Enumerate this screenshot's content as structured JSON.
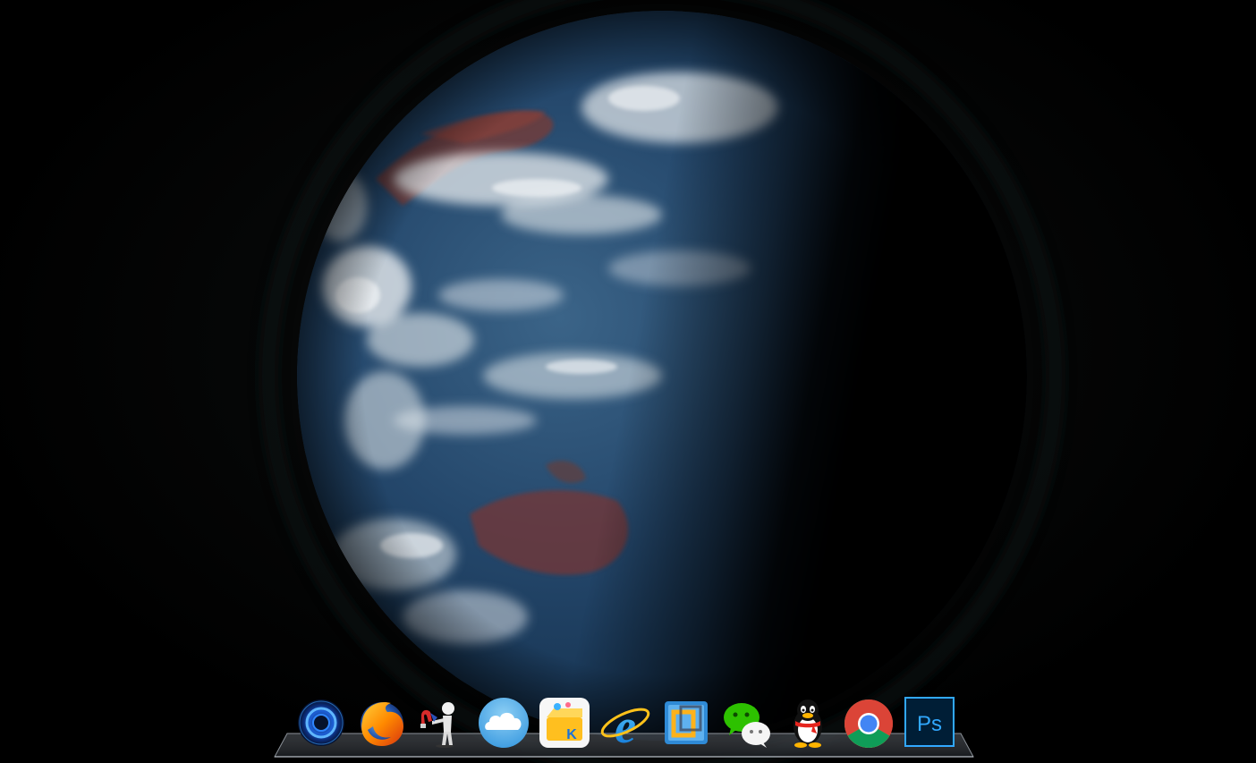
{
  "desktop": {
    "wallpaper": "earth-from-space"
  },
  "dock": {
    "items": [
      {
        "icon": "blue-ring-app-icon"
      },
      {
        "icon": "firefox-icon"
      },
      {
        "icon": "figure-with-magnet-icon"
      },
      {
        "icon": "cloud-drive-icon"
      },
      {
        "icon": "kugou-music-icon",
        "text": "K"
      },
      {
        "icon": "internet-explorer-icon",
        "text": "e"
      },
      {
        "icon": "blue-window-app-icon"
      },
      {
        "icon": "wechat-icon"
      },
      {
        "icon": "qq-penguin-icon"
      },
      {
        "icon": "chrome-icon"
      },
      {
        "icon": "photoshop-icon",
        "text": "Ps"
      }
    ]
  },
  "colors": {
    "background": "#000000",
    "ocean": "#1d3c5e",
    "photoshop_blue": "#31a8ff",
    "wechat_green": "#2dc100",
    "firefox_orange": "#ff7a00"
  }
}
